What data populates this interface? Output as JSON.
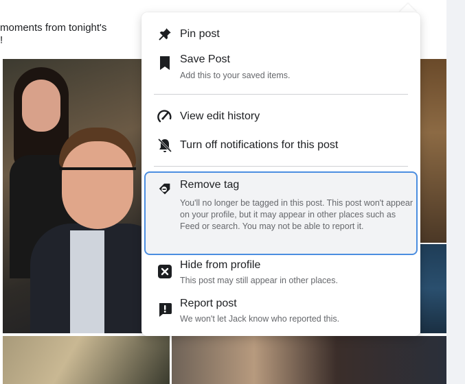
{
  "post": {
    "text_line1": "moments from tonight's",
    "text_line2": "!"
  },
  "menu": {
    "items": [
      {
        "icon": "pin-icon",
        "title": "Pin post",
        "subtitle": ""
      },
      {
        "icon": "bookmark-icon",
        "title": "Save Post",
        "subtitle": "Add this to your saved items."
      },
      {
        "icon": "edit-history-icon",
        "title": "View edit history",
        "subtitle": ""
      },
      {
        "icon": "bell-off-icon",
        "title": "Turn off notifications for this post",
        "subtitle": ""
      },
      {
        "icon": "tag-remove-icon",
        "title": "Remove tag",
        "subtitle": "You'll no longer be tagged in this post. This post won't appear on your profile, but it may appear in other places such as Feed or search. You may not be able to report it."
      },
      {
        "icon": "close-box-icon",
        "title": "Hide from profile",
        "subtitle": "This post may still appear in other places."
      },
      {
        "icon": "report-icon",
        "title": "Report post",
        "subtitle": "We won't let Jack know who reported this."
      }
    ]
  },
  "colors": {
    "text_primary": "#1c1e21",
    "text_secondary": "#65676b",
    "highlight_border": "#4a8de0",
    "highlight_bg": "#f2f3f5"
  }
}
